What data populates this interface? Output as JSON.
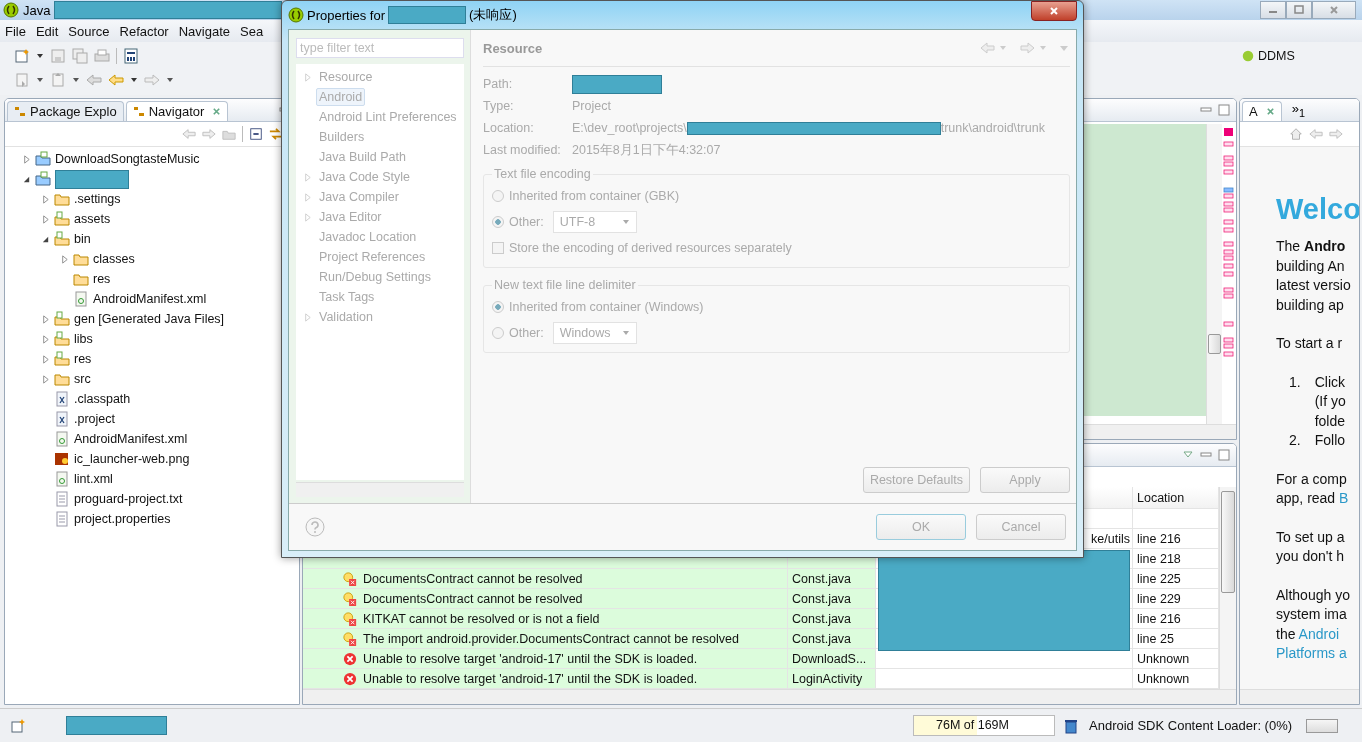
{
  "window": {
    "title": "Java"
  },
  "menu": [
    "File",
    "Edit",
    "Source",
    "Refactor",
    "Navigate",
    "Sea"
  ],
  "perspective": {
    "label": "DDMS"
  },
  "package_explorer": {
    "tabs": [
      {
        "label": "Package Explo",
        "selected": false
      },
      {
        "label": "Navigator",
        "selected": true
      }
    ],
    "tree": [
      {
        "label": "DownloadSongtasteMusic",
        "kind": "project",
        "expanded": false
      },
      {
        "kind": "project",
        "expanded": true,
        "children": [
          {
            "label": ".settings",
            "kind": "folder",
            "expanded": false
          },
          {
            "label": "assets",
            "kind": "source-folder",
            "expanded": false
          },
          {
            "label": "bin",
            "kind": "source-folder",
            "expanded": true,
            "children": [
              {
                "label": "classes",
                "kind": "folder",
                "expanded": false
              },
              {
                "label": "res",
                "kind": "folder"
              },
              {
                "label": "AndroidManifest.xml",
                "kind": "android-file"
              }
            ]
          },
          {
            "label": "gen [Generated Java Files]",
            "kind": "source-folder",
            "expanded": false
          },
          {
            "label": "libs",
            "kind": "source-folder",
            "expanded": false
          },
          {
            "label": "res",
            "kind": "source-folder",
            "expanded": false
          },
          {
            "label": "src",
            "kind": "folder",
            "expanded": false
          },
          {
            "label": ".classpath",
            "kind": "x-file"
          },
          {
            "label": ".project",
            "kind": "x-file"
          },
          {
            "label": "AndroidManifest.xml",
            "kind": "android-file"
          },
          {
            "label": "ic_launcher-web.png",
            "kind": "image-file"
          },
          {
            "label": "lint.xml",
            "kind": "android-file"
          },
          {
            "label": "proguard-project.txt",
            "kind": "text-file"
          },
          {
            "label": "project.properties",
            "kind": "text-file"
          }
        ]
      }
    ]
  },
  "problems": {
    "location_header": "Location",
    "rows": [
      {},
      {
        "path": "ke/utils",
        "location": "line 216"
      },
      {
        "location": "line 218"
      },
      {
        "kind": "warning",
        "description": "DocumentsContract cannot be resolved",
        "resource": "Const.java",
        "location": "line 225"
      },
      {
        "kind": "warning",
        "description": "DocumentsContract cannot be resolved",
        "resource": "Const.java",
        "location": "line 229"
      },
      {
        "kind": "warning",
        "description": "KITKAT cannot be resolved or is not a field",
        "resource": "Const.java",
        "location": "line 216"
      },
      {
        "kind": "warning",
        "description": "The import android.provider.DocumentsContract cannot be resolved",
        "resource": "Const.java",
        "location": "line 25"
      },
      {
        "kind": "error",
        "description": "Unable to resolve target 'android-17' until the SDK is loaded.",
        "resource": "DownloadS...",
        "location": "Unknown"
      },
      {
        "kind": "error",
        "description": "Unable to resolve target 'android-17' until the SDK is loaded.",
        "resource": "LoginActivity",
        "location": "Unknown"
      }
    ]
  },
  "welcome": {
    "tabs": [
      {
        "label": "A",
        "selected": true
      }
    ],
    "overflow": "»$_{1}$",
    "heading": "Welco",
    "blocks": [
      {
        "kind": "paragraph",
        "segments": [
          {
            "text": "The **Andro**\nbuilding An\nlatest versio\nbuilding ap"
          }
        ]
      },
      {
        "kind": "paragraph",
        "segments": [
          {
            "text": "To start a r"
          }
        ]
      },
      {
        "kind": "list",
        "items": [
          {
            "number": "1.",
            "text": "Click\n(If yo\nfolde"
          },
          {
            "number": "2.",
            "text": "Follo"
          }
        ]
      },
      {
        "kind": "paragraph",
        "segments": [
          {
            "text": "For a comp\napp, read "
          },
          {
            "text": "B",
            "link": true
          }
        ]
      },
      {
        "kind": "paragraph",
        "segments": [
          {
            "text": "To set up a\nyou don't h"
          }
        ]
      },
      {
        "kind": "paragraph",
        "segments": [
          {
            "text": "Although yo\nsystem ima\nthe "
          },
          {
            "text": "Androi",
            "link": true
          },
          {
            "text": "Platforms a",
            "link": true,
            "line_break": true
          }
        ]
      }
    ]
  },
  "dialog": {
    "title": "Properties for",
    "status": "(未响应)",
    "filter_placeholder": "type filter text",
    "nav": [
      {
        "label": "Resource",
        "expanded": false,
        "selected": false
      },
      {
        "label": "Android",
        "selected": true
      },
      {
        "label": "Android Lint Preferences",
        "selected": false
      },
      {
        "label": "Builders",
        "selected": false
      },
      {
        "label": "Java Build Path",
        "selected": false
      },
      {
        "label": "Java Code Style",
        "expanded": false,
        "selected": false
      },
      {
        "label": "Java Compiler",
        "expanded": false,
        "selected": false
      },
      {
        "label": "Java Editor",
        "expanded": false,
        "selected": false
      },
      {
        "label": "Javadoc Location",
        "selected": false
      },
      {
        "label": "Project References",
        "selected": false
      },
      {
        "label": "Run/Debug Settings",
        "selected": false
      },
      {
        "label": "Task Tags",
        "selected": false
      },
      {
        "label": "Validation",
        "expanded": false,
        "selected": false
      }
    ],
    "page_title": "Resource",
    "fields": [
      {
        "label": "Path:",
        "kind": "redacted"
      },
      {
        "label": "Type:",
        "kind": "text",
        "value": "Project"
      },
      {
        "label": "Location:",
        "kind": "path",
        "value": "E:\\dev_root\\projects\\",
        "value_end": "trunk\\android\\trunk"
      },
      {
        "label": "Last modified:",
        "kind": "text",
        "value": "2015年8月1日下午4:32:07"
      }
    ],
    "groups": [
      {
        "title": "Text file encoding",
        "options": [
          {
            "label": "Inherited from container (GBK)",
            "selected": false
          },
          {
            "label": "Other:",
            "selected": true,
            "combo": "UTF-8"
          }
        ],
        "checkbox": {
          "label": "Store the encoding of derived resources separately",
          "checked": false
        }
      },
      {
        "title": "New text file line delimiter",
        "options": [
          {
            "label": "Inherited from container (Windows)",
            "selected": true
          },
          {
            "label": "Other:",
            "selected": false,
            "combo": "Windows"
          }
        ]
      }
    ],
    "buttons": {
      "restore": "Restore Defaults",
      "apply": "Apply",
      "ok": "OK",
      "cancel": "Cancel"
    }
  },
  "status_bar": {
    "heap": {
      "used": "76M",
      "total": "of 169M",
      "level": 0.45
    },
    "loader": "Android SDK Content Loader: (0%)",
    "progress": {
      "level": 0
    }
  }
}
